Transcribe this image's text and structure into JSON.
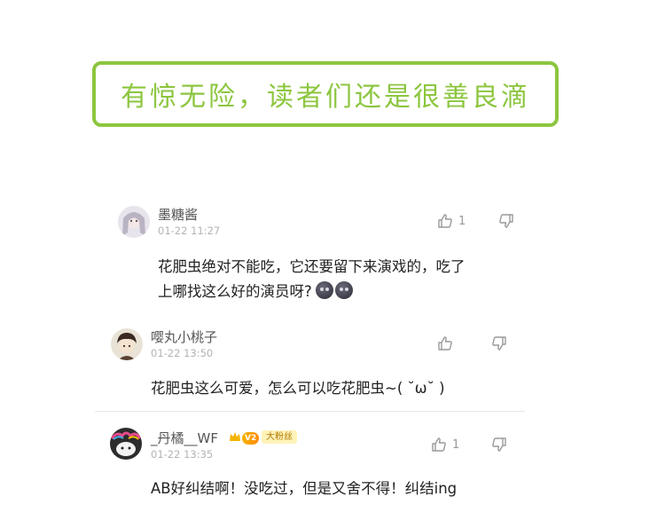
{
  "banner": {
    "text": "有惊无险，读者们还是很善良滴"
  },
  "comments": [
    {
      "username": "墨糖酱",
      "time": "01-22 11:27",
      "likes": "1",
      "text_line1": "花肥虫绝对不能吃，它还要留下来演戏的，吃了",
      "text_line2": "上哪找这么好的演员呀?",
      "avatar_icon": "avatar-girl-icon"
    },
    {
      "username": "嘤丸小桃子",
      "time": "01-22 13:50",
      "likes": "",
      "text": "花肥虫这么可爱，怎么可以吃花肥虫~(   ˘ω˘ )",
      "avatar_icon": "avatar-boy-icon"
    },
    {
      "username": "_丹橘__WF",
      "time": "01-22 13:35",
      "likes": "1",
      "level_badge": "V2",
      "fan_badge": "大粉丝",
      "text": "AB好纠结啊！没吃过，但是又舍不得！纠结ing",
      "avatar_icon": "avatar-cartoon-icon"
    }
  ],
  "colors": {
    "accent": "#8cc63f",
    "icon": "#999999"
  }
}
